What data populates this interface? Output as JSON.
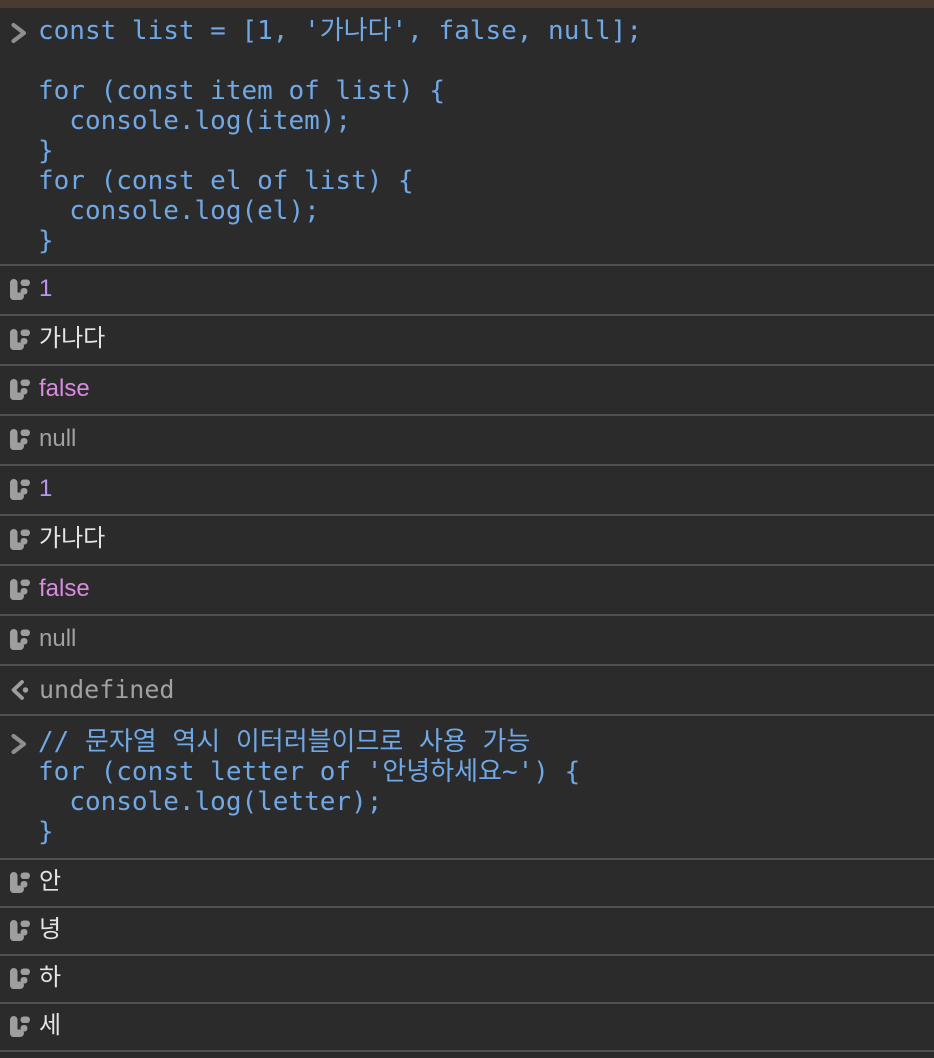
{
  "console": {
    "colors": {
      "background": "#2b2b2b",
      "top_strip": "#4a3b31",
      "row_separator": "#515151",
      "input_code": "#70a8e6",
      "prompt_chevron": "#8e8e8e",
      "row_icon": "#9e9e9e",
      "number_value": "#bb94ee",
      "string_value": "#e4e4e2",
      "boolean_value": "#d88be0",
      "null_value": "#a1a19f",
      "undefined_value": "#a1a19f"
    },
    "icons": {
      "prompt": "chevron-right-icon",
      "log": "console-log-icon",
      "result": "return-value-arrow-icon"
    },
    "entries": [
      {
        "type": "input",
        "lines": [
          "const list = [1, '가나다', false, null];",
          "",
          "for (const item of list) {",
          "  console.log(item);",
          "}",
          "for (const el of list) {",
          "  console.log(el);",
          "}"
        ]
      },
      {
        "type": "log",
        "value": "1",
        "value_type": "number"
      },
      {
        "type": "log",
        "value": "가나다",
        "value_type": "string"
      },
      {
        "type": "log",
        "value": "false",
        "value_type": "boolean"
      },
      {
        "type": "log",
        "value": "null",
        "value_type": "null"
      },
      {
        "type": "log",
        "value": "1",
        "value_type": "number"
      },
      {
        "type": "log",
        "value": "가나다",
        "value_type": "string"
      },
      {
        "type": "log",
        "value": "false",
        "value_type": "boolean"
      },
      {
        "type": "log",
        "value": "null",
        "value_type": "null"
      },
      {
        "type": "result",
        "value": "undefined",
        "value_type": "undefined"
      },
      {
        "type": "input",
        "lines": [
          "// 문자열 역시 이터러블이므로 사용 가능",
          "for (const letter of '안녕하세요~') {",
          "  console.log(letter);",
          "}"
        ]
      },
      {
        "type": "log",
        "value": "안",
        "value_type": "string"
      },
      {
        "type": "log",
        "value": "녕",
        "value_type": "string"
      },
      {
        "type": "log",
        "value": "하",
        "value_type": "string"
      },
      {
        "type": "log",
        "value": "세",
        "value_type": "string"
      }
    ]
  }
}
